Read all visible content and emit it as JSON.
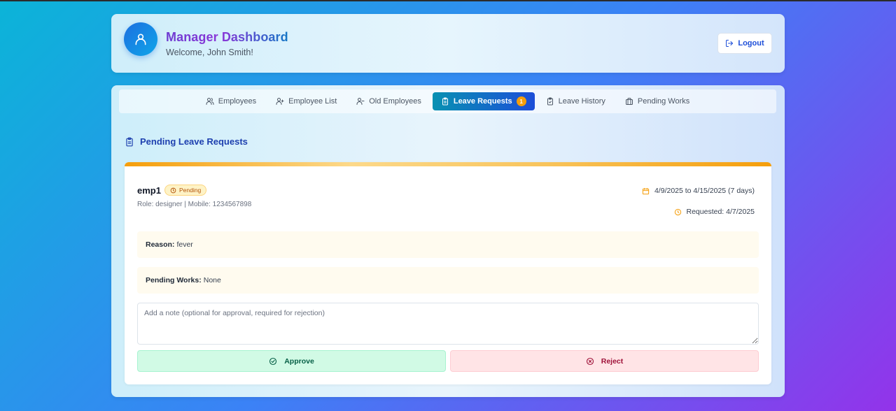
{
  "colors": {
    "accent": "#1d4ed8",
    "warning": "#f59e0b",
    "approve": "#065f46",
    "reject": "#9f1239"
  },
  "header": {
    "avatar_icon": "user-icon",
    "title": "Manager Dashboard",
    "welcome": "Welcome, John Smith!",
    "logout_label": "Logout",
    "logout_icon": "logout-icon"
  },
  "tabs": [
    {
      "label": "Employees",
      "icon": "users-icon"
    },
    {
      "label": "Employee List",
      "icon": "user-plus-icon"
    },
    {
      "label": "Old Employees",
      "icon": "user-minus-icon"
    },
    {
      "label": "Leave Requests",
      "icon": "clipboard-icon",
      "active": true,
      "badge": "1"
    },
    {
      "label": "Leave History",
      "icon": "clipboard-check-icon"
    },
    {
      "label": "Pending Works",
      "icon": "briefcase-icon"
    }
  ],
  "section": {
    "title": "Pending Leave Requests",
    "icon": "clipboard-icon"
  },
  "request": {
    "employee": "emp1",
    "status": "Pending",
    "meta": "Role: designer | Mobile: 1234567898",
    "date_range": "4/9/2025 to 4/15/2025 (7 days)",
    "requested": "Requested: 4/7/2025",
    "reason_label": "Reason:",
    "reason": "fever",
    "pending_works_label": "Pending Works:",
    "pending_works": "None",
    "note_placeholder": "Add a note (optional for approval, required for rejection)",
    "approve_label": "Approve",
    "reject_label": "Reject"
  }
}
